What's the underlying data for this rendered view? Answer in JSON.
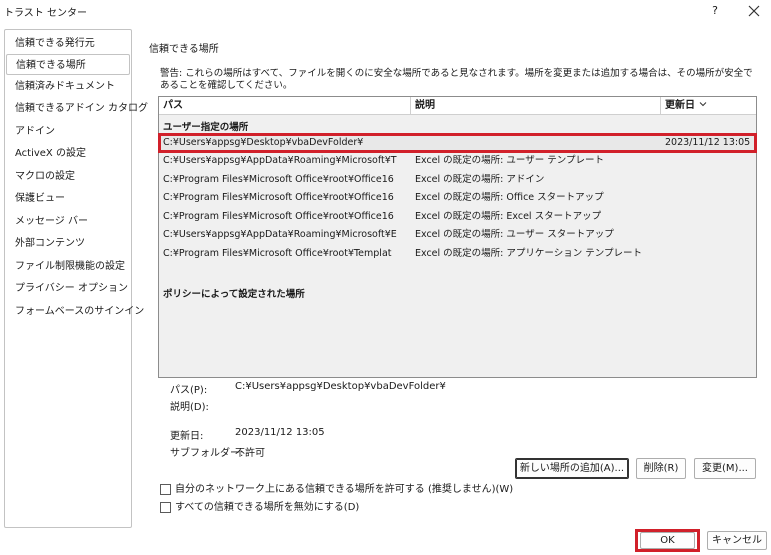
{
  "window": {
    "title": "トラスト センター",
    "help_label": "?",
    "close_icon": "close-icon"
  },
  "sidebar": {
    "items": [
      {
        "label": "信頼できる発行元"
      },
      {
        "label": "信頼できる場所",
        "selected": true
      },
      {
        "label": "信頼済みドキュメント"
      },
      {
        "label": "信頼できるアドイン カタログ"
      },
      {
        "label": "アドイン"
      },
      {
        "label": "ActiveX の設定"
      },
      {
        "label": "マクロの設定"
      },
      {
        "label": "保護ビュー"
      },
      {
        "label": "メッセージ バー"
      },
      {
        "label": "外部コンテンツ"
      },
      {
        "label": "ファイル制限機能の設定"
      },
      {
        "label": "プライバシー オプション"
      },
      {
        "label": "フォームベースのサインイン"
      }
    ]
  },
  "main": {
    "section_title": "信頼できる場所",
    "warning_text": "警告: これらの場所はすべて、ファイルを開くのに安全な場所であると見なされます。場所を変更または追加する場合は、その場所が安全であることを確認してください。",
    "table": {
      "columns": {
        "path": "パス",
        "description": "説明",
        "modified": "更新日",
        "sort_icon": "chevron-down-icon"
      },
      "user_group_label": "ユーザー指定の場所",
      "rows": [
        {
          "path": "C:¥Users¥appsg¥Desktop¥vbaDevFolder¥",
          "description": "",
          "modified": "2023/11/12 13:05"
        },
        {
          "path": "C:¥Users¥appsg¥AppData¥Roaming¥Microsoft¥T",
          "description": "Excel の既定の場所: ユーザー テンプレート",
          "modified": ""
        },
        {
          "path": "C:¥Program Files¥Microsoft Office¥root¥Office16",
          "description": "Excel の既定の場所: アドイン",
          "modified": ""
        },
        {
          "path": "C:¥Program Files¥Microsoft Office¥root¥Office16",
          "description": "Excel の既定の場所: Office スタートアップ",
          "modified": ""
        },
        {
          "path": "C:¥Program Files¥Microsoft Office¥root¥Office16",
          "description": "Excel の既定の場所: Excel スタートアップ",
          "modified": ""
        },
        {
          "path": "C:¥Users¥appsg¥AppData¥Roaming¥Microsoft¥E",
          "description": "Excel の既定の場所: ユーザー スタートアップ",
          "modified": ""
        },
        {
          "path": "C:¥Program Files¥Microsoft Office¥root¥Templat",
          "description": "Excel の既定の場所: アプリケーション テンプレート",
          "modified": ""
        }
      ],
      "policy_group_label": "ポリシーによって設定された場所"
    },
    "details": {
      "path_label": "パス(P):",
      "path_value": "C:¥Users¥appsg¥Desktop¥vbaDevFolder¥",
      "description_label": "説明(D):",
      "modified_label": "更新日:",
      "modified_value": "2023/11/12 13:05",
      "subfolders_label": "サブフォルダー:",
      "subfolders_value": "不許可"
    },
    "buttons": {
      "add_new": "新しい場所の追加(A)...",
      "remove": "削除(R)",
      "modify": "変更(M)..."
    },
    "checkboxes": {
      "allow_network": "自分のネットワーク上にある信頼できる場所を許可する (推奨しません)(W)",
      "disable_all": "すべての信頼できる場所を無効にする(D)"
    }
  },
  "footer": {
    "ok": "OK",
    "cancel": "キャンセル"
  },
  "colors": {
    "highlight_border": "#d1202a",
    "table_bg": "#f0f0f0"
  }
}
